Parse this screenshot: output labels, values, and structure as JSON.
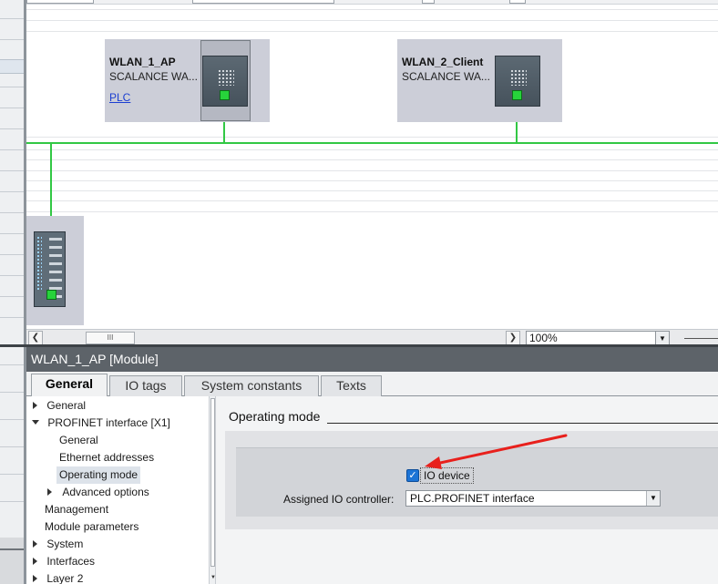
{
  "canvas": {
    "devices": [
      {
        "name": "WLAN_1_AP",
        "type": "SCALANCE WA...",
        "link": "PLC"
      },
      {
        "name": "WLAN_2_Client",
        "type": "SCALANCE WA..."
      }
    ],
    "network_color": "#32c844",
    "port_color": "#27d33b"
  },
  "scrollbar": {
    "left_icon": "chevron-left-icon",
    "right_icon": "chevron-right-icon",
    "thumb_grip": "III"
  },
  "zoom": {
    "value": "100%"
  },
  "inspector": {
    "title": "WLAN_1_AP [Module]",
    "tabs": [
      {
        "label": "General",
        "active": true
      },
      {
        "label": "IO tags",
        "active": false
      },
      {
        "label": "System constants",
        "active": false
      },
      {
        "label": "Texts",
        "active": false
      }
    ],
    "nav": [
      {
        "label": "General",
        "arrow": "right"
      },
      {
        "label": "PROFINET interface [X1]",
        "arrow": "down"
      },
      {
        "label": "General",
        "arrow": "none"
      },
      {
        "label": "Ethernet addresses",
        "arrow": "none"
      },
      {
        "label": "Operating mode",
        "arrow": "none",
        "selected": true
      },
      {
        "label": "Advanced options",
        "arrow": "right"
      },
      {
        "label": "Management",
        "arrow": "none"
      },
      {
        "label": "Module parameters",
        "arrow": "none"
      },
      {
        "label": "System",
        "arrow": "right"
      },
      {
        "label": "Interfaces",
        "arrow": "right"
      },
      {
        "label": "Layer 2",
        "arrow": "right"
      }
    ],
    "section_title": "Operating mode",
    "io_device": {
      "label": "IO device",
      "checked": true
    },
    "assigned_controller": {
      "label": "Assigned IO controller:",
      "value": "PLC.PROFINET interface"
    }
  },
  "annotation": {
    "arrow_color": "#e8201c"
  }
}
